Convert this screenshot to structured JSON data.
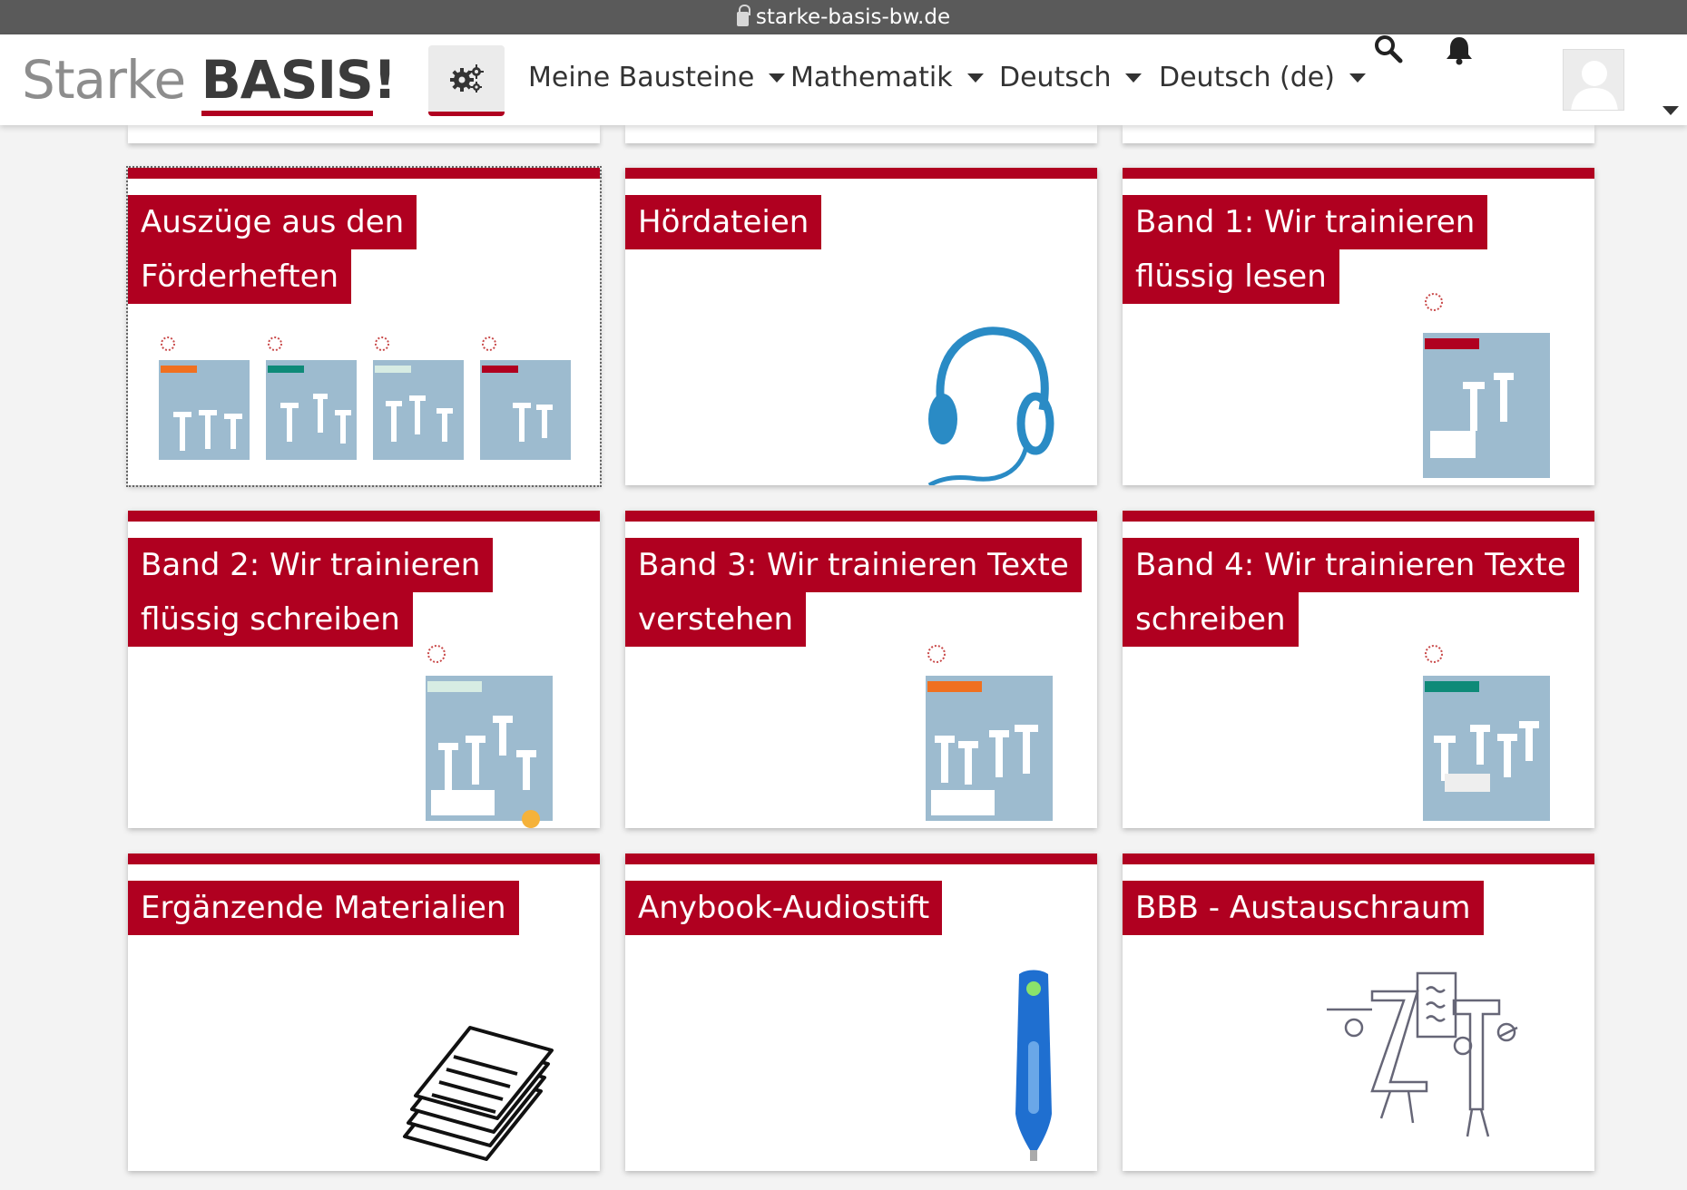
{
  "browser": {
    "url": "starke-basis-bw.de"
  },
  "navbar": {
    "brand_light": "Starke",
    "brand_bold": "BASIS",
    "brand_mark": "!",
    "menu": [
      {
        "label": "Meine Bausteine"
      },
      {
        "label": "Mathematik"
      },
      {
        "label": "Deutsch"
      },
      {
        "label": "Deutsch (de)"
      }
    ]
  },
  "colors": {
    "accent": "#b00020",
    "booklet_cover": "#9dbbcf"
  },
  "icons": [
    "gear-icon",
    "search-icon",
    "bell-icon",
    "avatar",
    "headphones-icon",
    "papers-icon",
    "audio-pen-icon",
    "letters-figures-icon"
  ],
  "cards": [
    {
      "title_lines": [
        "Auszüge aus den",
        "Förderheften"
      ]
    },
    {
      "title_lines": [
        "Hördateien"
      ]
    },
    {
      "title_lines": [
        "Band 1: Wir trainieren",
        "flüssig lesen"
      ]
    },
    {
      "title_lines": [
        "Band 2: Wir trainieren",
        "flüssig schreiben"
      ]
    },
    {
      "title_lines": [
        "Band 3: Wir trainieren Texte",
        "verstehen"
      ]
    },
    {
      "title_lines": [
        "Band 4: Wir trainieren Texte",
        "schreiben"
      ]
    },
    {
      "title_lines": [
        "Ergänzende Materialien"
      ]
    },
    {
      "title_lines": [
        "Anybook-Audiostift"
      ]
    },
    {
      "title_lines": [
        "BBB - Austauschraum"
      ]
    }
  ]
}
